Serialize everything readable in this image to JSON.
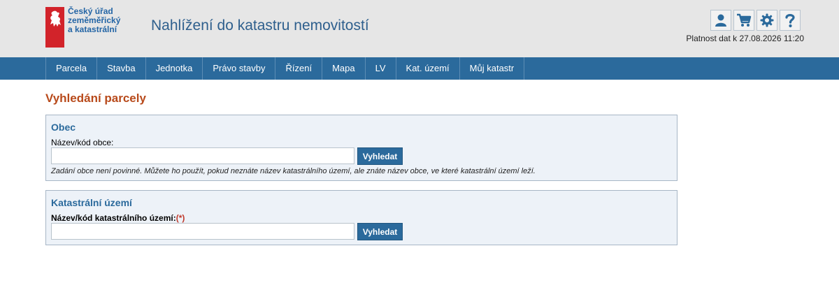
{
  "header": {
    "logo_lines": [
      "Český úřad",
      "zeměměřický",
      "a katastrální"
    ],
    "app_title": "Nahlížení do katastru nemovitostí",
    "validity": "Platnost dat k 27.08.2026 11:20",
    "icons": [
      "user-icon",
      "cart-icon",
      "gear-icon",
      "help-icon"
    ]
  },
  "nav": {
    "items": [
      "Parcela",
      "Stavba",
      "Jednotka",
      "Právo stavby",
      "Řízení",
      "Mapa",
      "LV",
      "Kat. území",
      "Můj katastr"
    ]
  },
  "page": {
    "title": "Vyhledání parcely"
  },
  "obec": {
    "heading": "Obec",
    "label": "Název/kód obce:",
    "value": "",
    "button": "Vyhledat",
    "hint": "Zadání obce není povinné. Můžete ho použít, pokud neznáte název katastrálního území, ale znáte název obce, ve které katastrální území leží."
  },
  "ku": {
    "heading": "Katastrální území",
    "label": "Název/kód katastrálního území:",
    "required_mark": "(*)",
    "value": "",
    "button": "Vyhledat"
  },
  "colors": {
    "nav_bg": "#2b6a9c",
    "title_orange": "#b84a1b",
    "logo_red": "#d2232a"
  }
}
